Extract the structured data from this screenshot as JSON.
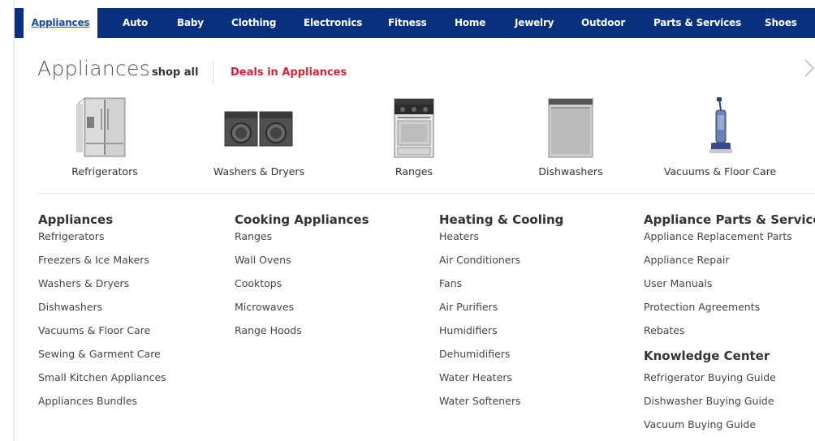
{
  "nav": {
    "items": [
      {
        "label": "Appliances",
        "active": true
      },
      {
        "label": "Auto"
      },
      {
        "label": "Baby"
      },
      {
        "label": "Clothing"
      },
      {
        "label": "Electronics"
      },
      {
        "label": "Fitness"
      },
      {
        "label": "Home"
      },
      {
        "label": "Jewelry"
      },
      {
        "label": "Outdoor"
      },
      {
        "label": "Parts & Services"
      },
      {
        "label": "Shoes"
      }
    ]
  },
  "header": {
    "title": "Appliances",
    "shop_all": "shop all",
    "deals": "Deals in Appliances"
  },
  "featured": [
    {
      "label": "Refrigerators",
      "icon": "refrigerator-icon"
    },
    {
      "label": "Washers & Dryers",
      "icon": "washer-dryer-icon"
    },
    {
      "label": "Ranges",
      "icon": "range-icon"
    },
    {
      "label": "Dishwashers",
      "icon": "dishwasher-icon"
    },
    {
      "label": "Vacuums & Floor Care",
      "icon": "vacuum-icon"
    }
  ],
  "columns": [
    {
      "heading": "Appliances",
      "links": [
        "Refrigerators",
        "Freezers & Ice Makers",
        "Washers & Dryers",
        "Dishwashers",
        "Vacuums & Floor Care",
        "Sewing & Garment Care",
        "Small Kitchen Appliances",
        "Appliances Bundles"
      ]
    },
    {
      "heading": "Cooking Appliances",
      "links": [
        "Ranges",
        "Wall Ovens",
        "Cooktops",
        "Microwaves",
        "Range Hoods"
      ]
    },
    {
      "heading": "Heating & Cooling",
      "links": [
        "Heaters",
        "Air Conditioners",
        "Fans",
        "Air Purifiers",
        "Humidifiers",
        "Dehumidifiers",
        "Water Heaters",
        "Water Softeners"
      ]
    },
    {
      "heading": "Appliance Parts & Services",
      "links": [
        "Appliance Replacement Parts",
        "Appliance Repair",
        "User Manuals",
        "Protection Agreements",
        "Rebates"
      ],
      "subheading": "Knowledge Center",
      "sublinks": [
        "Refrigerator Buying Guide",
        "Dishwasher Buying Guide",
        "Vacuum Buying Guide"
      ]
    }
  ],
  "colors": {
    "nav_bg": "#08307f",
    "nav_text": "#ffffff",
    "active_text": "#1e4c9a",
    "deals": "#d0243a"
  }
}
